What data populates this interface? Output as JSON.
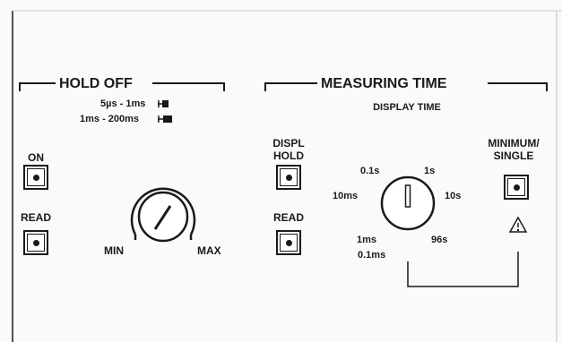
{
  "holdoff": {
    "title": "HOLD OFF",
    "range1": "5µs - 1ms",
    "range2": "1ms - 200ms",
    "on_label": "ON",
    "read_label": "READ",
    "knob_min": "MIN",
    "knob_max": "MAX"
  },
  "measuring": {
    "title": "MEASURING TIME",
    "subtitle": "DISPLAY TIME",
    "displ_hold_label_1": "DISPL",
    "displ_hold_label_2": "HOLD",
    "read_label": "READ",
    "dial": {
      "t0_1s": "0.1s",
      "t1s": "1s",
      "t10ms": "10ms",
      "t10s": "10s",
      "t1ms": "1ms",
      "t96s": "96s",
      "t0_1ms": "0.1ms"
    },
    "minimum_label_1": "MINIMUM/",
    "minimum_label_2": "SINGLE"
  },
  "colors": {
    "ink": "#1a1a1a",
    "panel": "#fafafa"
  },
  "icons": {
    "warning": "warning-triangle-icon",
    "hold-indicator": "hold-off-indicator-icon"
  }
}
